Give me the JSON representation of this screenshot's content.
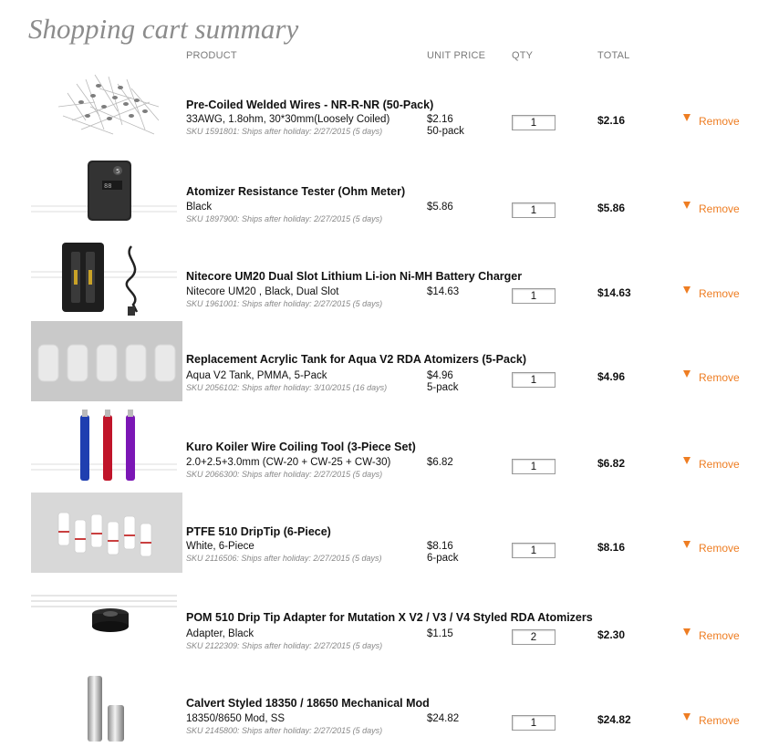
{
  "page_title": "Shopping cart summary",
  "columns": {
    "product": "PRODUCT",
    "unit_price": "UNIT PRICE",
    "qty": "QTY",
    "total": "TOTAL"
  },
  "remove_label": "Remove",
  "colors": {
    "accent": "#ee7d22",
    "title": "#8c8c8c",
    "muted": "#888888"
  },
  "items": [
    {
      "name": "Pre-Coiled Welded Wires - NR-R-NR (50-Pack)",
      "variant": "33AWG, 1.8ohm, 30*30mm(Loosely Coiled)",
      "sku": "SKU 1591801: Ships after holiday: 2/27/2015 (5 days)",
      "unit_price": "$2.16",
      "pack": "50-pack",
      "qty": "1",
      "total": "$2.16",
      "image": "coiled-wires-image"
    },
    {
      "name": "Atomizer Resistance Tester (Ohm Meter)",
      "variant": "Black",
      "sku": "SKU 1897900: Ships after holiday: 2/27/2015 (5 days)",
      "unit_price": "$5.86",
      "pack": "",
      "qty": "1",
      "total": "$5.86",
      "image": "ohm-meter-image"
    },
    {
      "name": "Nitecore UM20 Dual Slot Lithium Li-ion Ni-MH Battery Charger",
      "variant": "Nitecore UM20 , Black, Dual Slot",
      "sku": "SKU 1961001: Ships after holiday: 2/27/2015 (5 days)",
      "unit_price": "$14.63",
      "pack": "",
      "qty": "1",
      "total": "$14.63",
      "image": "battery-charger-image"
    },
    {
      "name": "Replacement Acrylic Tank for Aqua V2 RDA Atomizers (5-Pack)",
      "variant": "Aqua V2 Tank, PMMA, 5-Pack",
      "sku": "SKU 2056102: Ships after holiday: 3/10/2015 (16 days)",
      "unit_price": "$4.96",
      "pack": "5-pack",
      "qty": "1",
      "total": "$4.96",
      "image": "acrylic-tanks-image"
    },
    {
      "name": "Kuro Koiler Wire Coiling Tool (3-Piece Set)",
      "variant": "2.0+2.5+3.0mm (CW-20 + CW-25 + CW-30)",
      "sku": "SKU 2066300: Ships after holiday: 2/27/2015 (5 days)",
      "unit_price": "$6.82",
      "pack": "",
      "qty": "1",
      "total": "$6.82",
      "image": "coiling-tools-image"
    },
    {
      "name": "PTFE 510 DripTip (6-Piece)",
      "variant": "White, 6-Piece",
      "sku": "SKU 2116506: Ships after holiday: 2/27/2015 (5 days)",
      "unit_price": "$8.16",
      "pack": "6-pack",
      "qty": "1",
      "total": "$8.16",
      "image": "drip-tips-image"
    },
    {
      "name": "POM 510 Drip Tip Adapter for Mutation X V2 / V3 / V4 Styled RDA Atomizers",
      "variant": "Adapter, Black",
      "sku": "SKU 2122309: Ships after holiday: 2/27/2015 (5 days)",
      "unit_price": "$1.15",
      "pack": "",
      "qty": "2",
      "total": "$2.30",
      "image": "drip-tip-adapter-image"
    },
    {
      "name": "Calvert Styled 18350 / 18650 Mechanical Mod",
      "variant": "18350/8650 Mod, SS",
      "sku": "SKU 2145800: Ships after holiday: 2/27/2015 (5 days)",
      "unit_price": "$24.82",
      "pack": "",
      "qty": "1",
      "total": "$24.82",
      "image": "mechanical-mod-image"
    }
  ]
}
